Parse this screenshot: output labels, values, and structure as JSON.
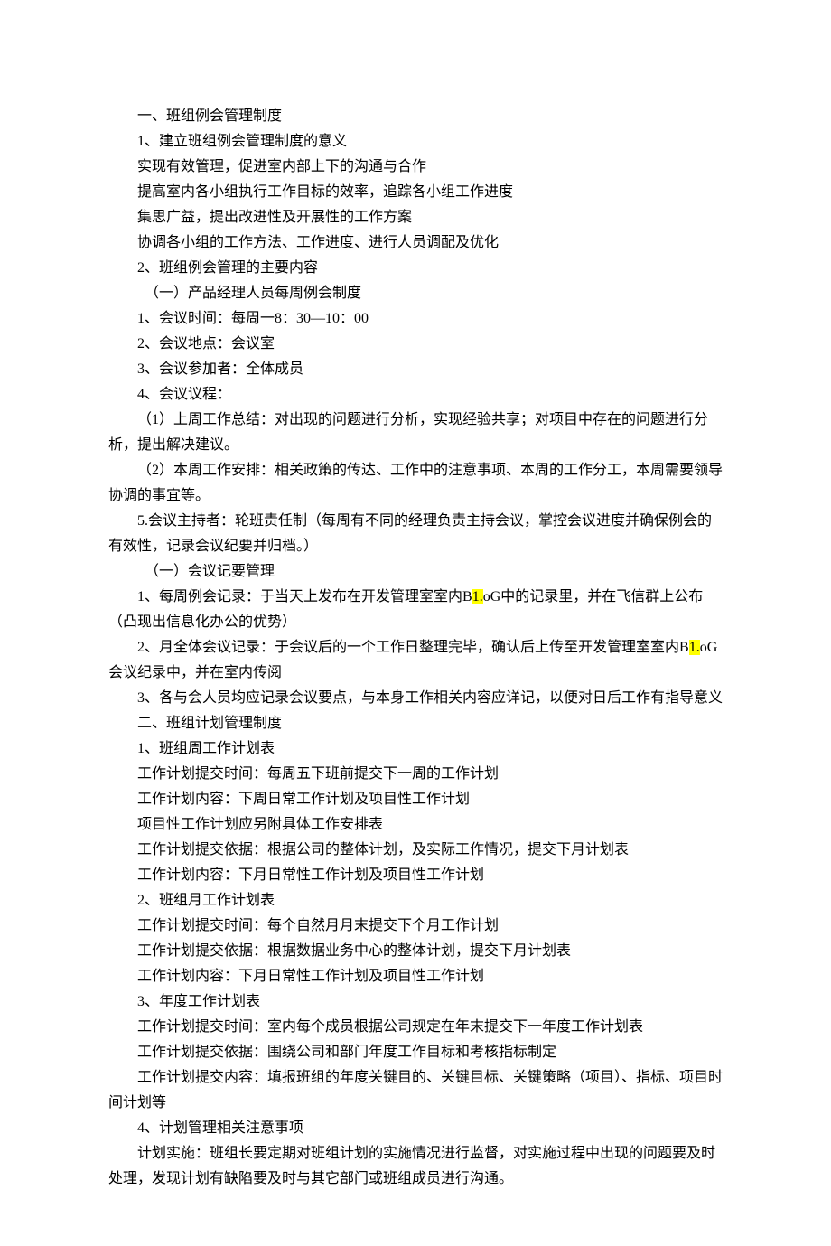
{
  "highlight": "1.",
  "paragraphs": [
    {
      "indent": 1,
      "text": "一、班组例会管理制度"
    },
    {
      "indent": 1,
      "text": "1、建立班组例会管理制度的意义"
    },
    {
      "indent": 1,
      "text": "实现有效管理，促进室内部上下的沟通与合作"
    },
    {
      "indent": 1,
      "text": "提高室内各小组执行工作目标的效率，追踪各小组工作进度"
    },
    {
      "indent": 1,
      "text": "集思广益，提出改进性及开展性的工作方案"
    },
    {
      "indent": 1,
      "text": "协调各小组的工作方法、工作进度、进行人员调配及优化"
    },
    {
      "indent": 1,
      "text": "2、班组例会管理的主要内容"
    },
    {
      "indent": 1,
      "text": "　（一）产品经理人员每周例会制度"
    },
    {
      "indent": 1,
      "text": "1、会议时间：每周一8：30—10：00"
    },
    {
      "indent": 1,
      "text": "2、会议地点：会议室"
    },
    {
      "indent": 1,
      "text": "3、会议参加者：全体成员"
    },
    {
      "indent": 1,
      "text": "4、会议议程："
    },
    {
      "indent": 1,
      "text": "（1）上周工作总结：对出现的问题进行分析，实现经验共享；对项目中存在的问题进行分析，提出解决建议。"
    },
    {
      "indent": 1,
      "text": "（2）本周工作安排：相关政策的传达、工作中的注意事项、本周的工作分工，本周需要领导协调的事宜等。"
    },
    {
      "indent": 1,
      "text": "5.会议主持者：轮班责任制（每周有不同的经理负责主持会议，掌控会议进度并确保例会的有效性，记录会议纪要并归档。）"
    },
    {
      "indent": 1,
      "text": "　（一）会议记要管理"
    },
    {
      "indent": 1,
      "span": [
        {
          "t": "1、每周例会记录：于当天上发布在开发管理室室内B"
        },
        {
          "t": "1.",
          "hl": true
        },
        {
          "t": "oG中的记录里，并在飞信群上公布（凸现出信息化办公的优势）"
        }
      ]
    },
    {
      "indent": 1,
      "span": [
        {
          "t": "2、月全体会议记录：于会议后的一个工作日整理完毕，确认后上传至开发管理室室内B"
        },
        {
          "t": "1.",
          "hl": true
        },
        {
          "t": "oG会议纪录中，并在室内传阅"
        }
      ]
    },
    {
      "indent": 1,
      "text": "3、各与会人员均应记录会议要点，与本身工作相关内容应详记，以便对日后工作有指导意义"
    },
    {
      "indent": 1,
      "text": "二、班组计划管理制度"
    },
    {
      "indent": 1,
      "text": "1、班组周工作计划表"
    },
    {
      "indent": 1,
      "text": "工作计划提交时间：每周五下班前提交下一周的工作计划"
    },
    {
      "indent": 1,
      "text": "工作计划内容：下周日常工作计划及项目性工作计划"
    },
    {
      "indent": 1,
      "text": "项目性工作计划应另附具体工作安排表"
    },
    {
      "indent": 1,
      "text": "工作计划提交依据：根据公司的整体计划，及实际工作情况，提交下月计划表"
    },
    {
      "indent": 1,
      "text": "工作计划内容：下月日常性工作计划及项目性工作计划"
    },
    {
      "indent": 1,
      "text": "2、班组月工作计划表"
    },
    {
      "indent": 1,
      "text": "工作计划提交时间：每个自然月月末提交下个月工作计划"
    },
    {
      "indent": 1,
      "text": "工作计划提交依据：根据数据业务中心的整体计划，提交下月计划表"
    },
    {
      "indent": 1,
      "text": "工作计划内容：下月日常性工作计划及项目性工作计划"
    },
    {
      "indent": 1,
      "text": "3、年度工作计划表"
    },
    {
      "indent": 1,
      "text": "工作计划提交时间：室内每个成员根据公司规定在年末提交下一年度工作计划表"
    },
    {
      "indent": 1,
      "text": "工作计划提交依据：围绕公司和部门年度工作目标和考核指标制定"
    },
    {
      "indent": 1,
      "text": "工作计划提交内容：填报班组的年度关键目的、关键目标、关键策略（项目）、指标、项目时间计划等"
    },
    {
      "indent": 1,
      "text": "4、计划管理相关注意事项"
    },
    {
      "indent": 1,
      "text": "计划实施：班组长要定期对班组计划的实施情况进行监督，对实施过程中出现的问题要及时处理，发现计划有缺陷要及时与其它部门或班组成员进行沟通。"
    }
  ]
}
